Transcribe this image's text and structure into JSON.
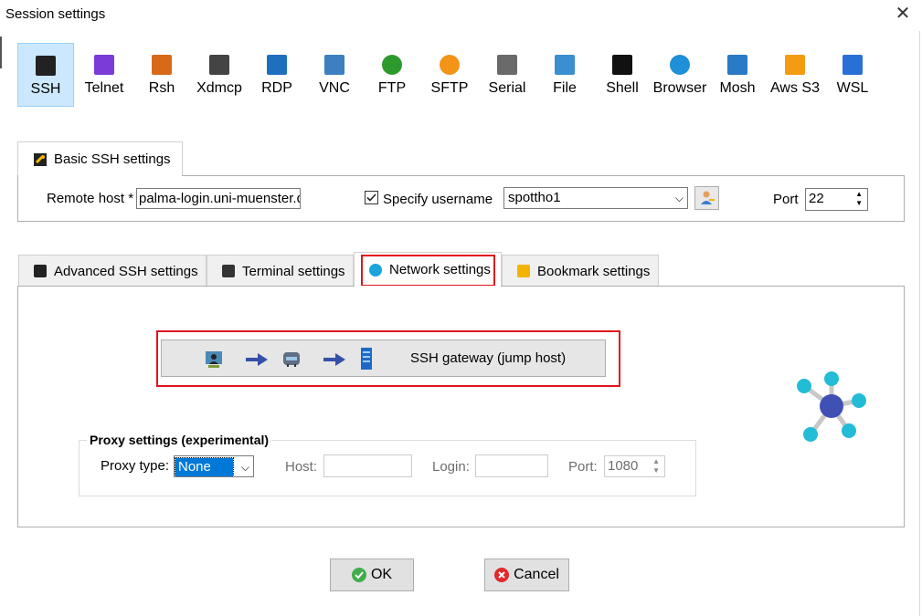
{
  "window": {
    "title": "Session settings"
  },
  "toolbar": [
    {
      "label": "SSH",
      "icon": "ssh-key-icon",
      "selected": true
    },
    {
      "label": "Telnet",
      "icon": "telnet-icon"
    },
    {
      "label": "Rsh",
      "icon": "rsh-icon"
    },
    {
      "label": "Xdmcp",
      "icon": "xdmcp-icon"
    },
    {
      "label": "RDP",
      "icon": "rdp-icon"
    },
    {
      "label": "VNC",
      "icon": "vnc-icon"
    },
    {
      "label": "FTP",
      "icon": "ftp-globe-icon"
    },
    {
      "label": "SFTP",
      "icon": "sftp-globe-icon"
    },
    {
      "label": "Serial",
      "icon": "serial-plug-icon"
    },
    {
      "label": "File",
      "icon": "file-monitor-icon"
    },
    {
      "label": "Shell",
      "icon": "shell-terminal-icon"
    },
    {
      "label": "Browser",
      "icon": "browser-globe-icon"
    },
    {
      "label": "Mosh",
      "icon": "mosh-antenna-icon"
    },
    {
      "label": "Aws S3",
      "icon": "aws-s3-cubes-icon"
    },
    {
      "label": "WSL",
      "icon": "wsl-windows-icon"
    }
  ],
  "basic": {
    "tab_label": "Basic SSH settings",
    "remote_host_label": "Remote host *",
    "remote_host_value": "palma-login.uni-muenster.d",
    "specify_username_label": "Specify username",
    "specify_username_checked": true,
    "username_value": "spottho1",
    "port_label": "Port",
    "port_value": "22"
  },
  "tabs": [
    {
      "label": "Advanced SSH settings",
      "icon": "wrench-icon"
    },
    {
      "label": "Terminal settings",
      "icon": "terminal-icon"
    },
    {
      "label": "Network settings",
      "icon": "network-icon",
      "active": true
    },
    {
      "label": "Bookmark settings",
      "icon": "star-icon"
    }
  ],
  "network": {
    "gateway_label": "SSH gateway (jump host)",
    "proxy_group_label": "Proxy settings (experimental)",
    "proxy_type_label": "Proxy type:",
    "proxy_type_value": "None",
    "host_label": "Host:",
    "host_value": "",
    "login_label": "Login:",
    "login_value": "",
    "port_label": "Port:",
    "port_value": "1080"
  },
  "buttons": {
    "ok": "OK",
    "cancel": "Cancel"
  },
  "colors": {
    "selection": "#cce8ff",
    "highlight": "#e0141d",
    "accent": "#0078d7"
  }
}
